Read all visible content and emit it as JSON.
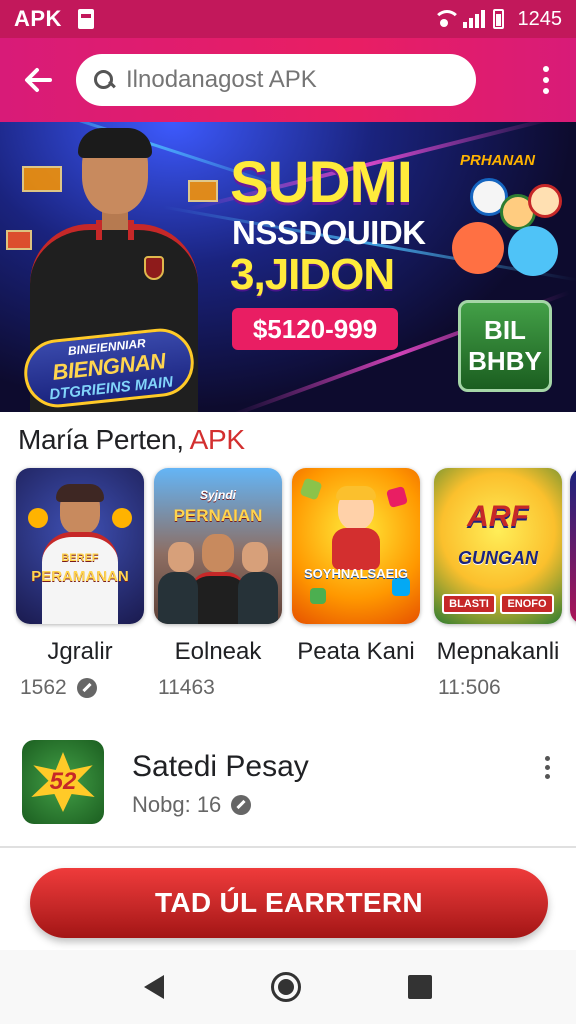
{
  "status_bar": {
    "app_label": "APK",
    "time": "1245"
  },
  "search": {
    "value": "",
    "placeholder": "Ilnodanagost APK"
  },
  "banner": {
    "title": "SUDMI",
    "subtitle_1": "NSSDOUIDK",
    "subtitle_2": "3,JIDON",
    "price": "$5120-999",
    "buy_label_1": "BIL",
    "buy_label_2": "BHBY",
    "mini_title": "PRHANAN",
    "logo_line_1": "BINEIENNIAR",
    "logo_line_2": "BIENGNAN",
    "logo_line_3": "DTGRIEINS MAIN"
  },
  "section": {
    "title_main": "María Perten, ",
    "title_accent": "APK"
  },
  "apps": [
    {
      "name": "Jgralir",
      "meta": "1562",
      "tile_text": "PERAMANAN",
      "tile_sub": "BEREF"
    },
    {
      "name": "Eolneak",
      "meta": "11463",
      "tile_text": "PERNAIAN",
      "tile_sub": "Syjndi"
    },
    {
      "name": "Peata Kani",
      "meta": "",
      "tile_text": "SOYHNALSAEIG",
      "tile_sub": ""
    },
    {
      "name": "Mepnakanli",
      "meta": "11:506",
      "tile_text": "GUNGAN",
      "tile_sub": "ARF",
      "tile_btn_1": "BLASTI",
      "tile_btn_2": "ENOFO"
    }
  ],
  "list_item": {
    "title": "Satedi Pesay",
    "subtitle": "Nobg: 16",
    "icon_text": "52"
  },
  "cta": {
    "label": "TAD ÚL EARRTERN"
  },
  "colors": {
    "primary": "#e91e63",
    "status": "#c2185b",
    "cta": "#c62828",
    "accent_text": "#d32f2f"
  }
}
